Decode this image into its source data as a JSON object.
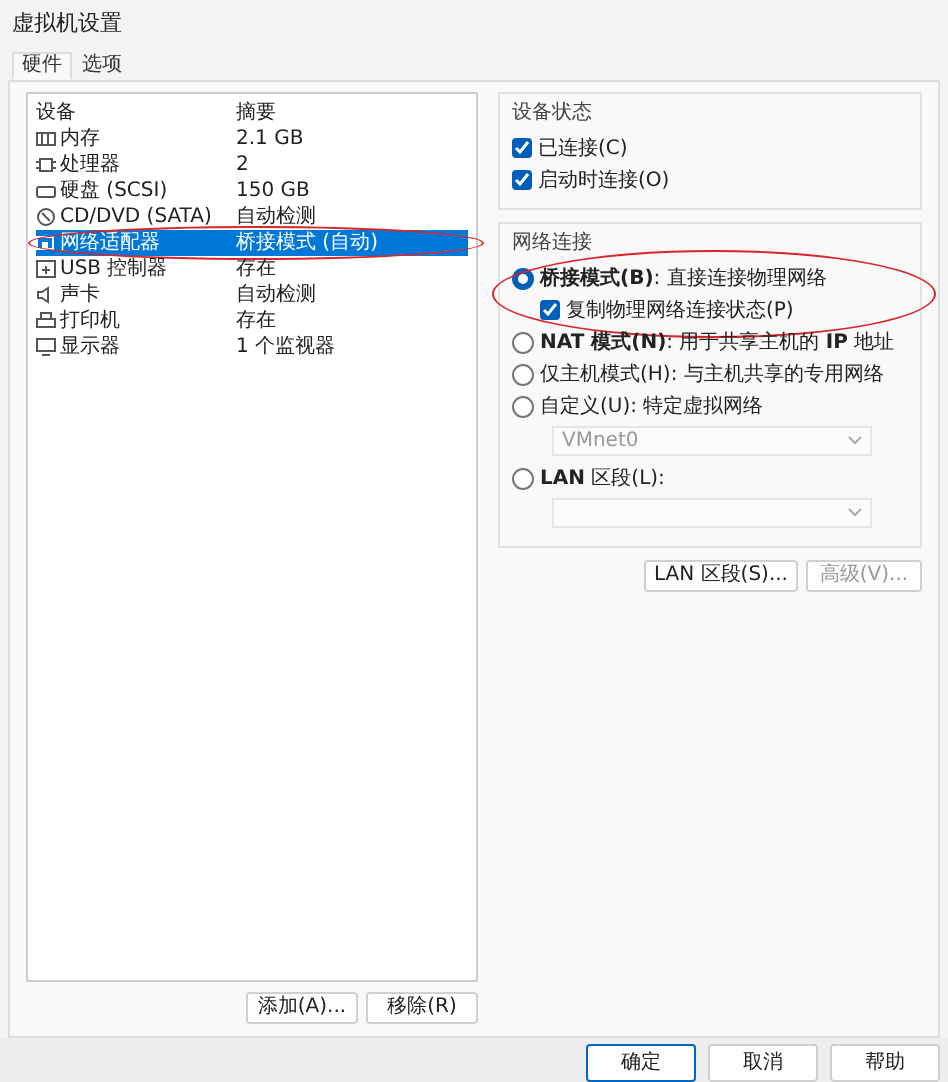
{
  "window": {
    "title": "虚拟机设置"
  },
  "tabs": [
    {
      "label": "硬件",
      "selected": true
    },
    {
      "label": "选项",
      "selected": false
    }
  ],
  "device_list": {
    "columns": [
      "设备",
      "摘要"
    ],
    "rows": [
      {
        "kind": "memory",
        "name": "内存",
        "summary": "2.1 GB",
        "selected": false
      },
      {
        "kind": "cpu",
        "name": "处理器",
        "summary": "2",
        "selected": false
      },
      {
        "kind": "disk",
        "name": "硬盘 (SCSI)",
        "summary": "150 GB",
        "selected": false
      },
      {
        "kind": "cd",
        "name": "CD/DVD (SATA)",
        "summary": "自动检测",
        "selected": false
      },
      {
        "kind": "network",
        "name": "网络适配器",
        "summary": "桥接模式 (自动)",
        "selected": true,
        "circled": true
      },
      {
        "kind": "usb",
        "name": "USB 控制器",
        "summary": "存在",
        "selected": false
      },
      {
        "kind": "sound",
        "name": "声卡",
        "summary": "自动检测",
        "selected": false
      },
      {
        "kind": "printer",
        "name": "打印机",
        "summary": "存在",
        "selected": false
      },
      {
        "kind": "display",
        "name": "显示器",
        "summary": "1 个监视器",
        "selected": false
      }
    ]
  },
  "list_buttons": [
    {
      "label": "添加(A)..."
    },
    {
      "label": "移除(R)"
    }
  ],
  "device_status": {
    "title": "设备状态",
    "options": [
      {
        "label": "已连接(C)",
        "checked": true
      },
      {
        "label": "启动时连接(O)",
        "checked": true
      }
    ]
  },
  "network_connection": {
    "title": "网络连接",
    "options": [
      {
        "kind": "radio",
        "label": "**桥接模式(B)**: 直接连接物理网络",
        "selected": true,
        "circled": true,
        "sub_option": {
          "label": "复制物理网络连接状态(P)",
          "checked": true
        }
      },
      {
        "kind": "radio",
        "label": "**NAT 模式(N)**: 用于共享主机的 **IP** 地址",
        "selected": false
      },
      {
        "kind": "radio",
        "label": "仅主机模式(H): 与主机共享的专用网络",
        "selected": false
      },
      {
        "kind": "radio",
        "label": "自定义(U): 特定虚拟网络",
        "selected": false,
        "dropdown": {
          "value": "VMnet0",
          "disabled": true
        }
      },
      {
        "kind": "radio",
        "label": "**LAN** 区段(L):",
        "selected": false,
        "dropdown": {
          "disabled": true
        }
      }
    ]
  },
  "network_buttons": [
    {
      "label": "LAN 区段(S)...",
      "disabled": false
    },
    {
      "label": "高级(V)...",
      "disabled": true
    }
  ],
  "footer_buttons": [
    {
      "label": "确定",
      "default": true
    },
    {
      "label": "取消",
      "default": false
    },
    {
      "label": "帮助",
      "default": false
    }
  ]
}
